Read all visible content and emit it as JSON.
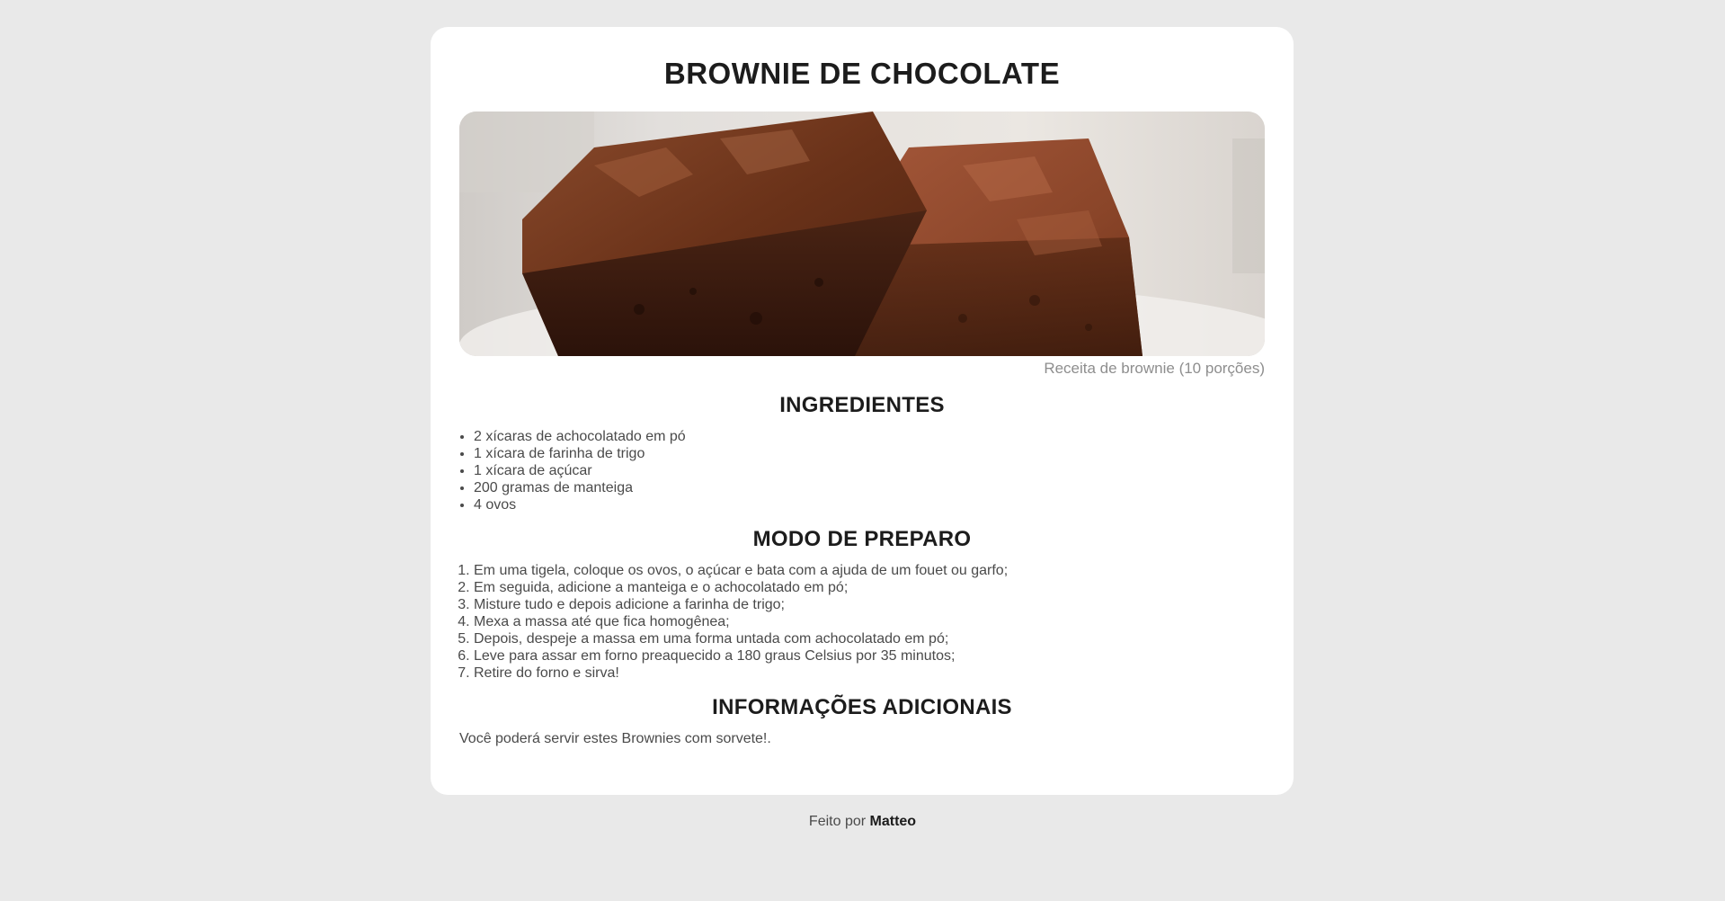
{
  "recipe": {
    "title": "BROWNIE DE CHOCOLATE",
    "image_caption": "Receita de brownie (10 porções)",
    "ingredients_heading": "INGREDIENTES",
    "ingredients": [
      "2 xícaras de achocolatado em pó",
      "1 xícara de farinha de trigo",
      "1 xícara de açúcar",
      "200 gramas de manteiga",
      "4 ovos"
    ],
    "preparation_heading": "MODO DE PREPARO",
    "steps": [
      "Em uma tigela, coloque os ovos, o açúcar e bata com a ajuda de um fouet ou garfo;",
      "Em seguida, adicione a manteiga e o achocolatado em pó;",
      "Misture tudo e depois adicione a farinha de trigo;",
      "Mexa a massa até que fica homogênea;",
      "Depois, despeje a massa em uma forma untada com achocolatado em pó;",
      "Leve para assar em forno preaquecido a 180 graus Celsius por 35 minutos;",
      "Retire do forno e sirva!"
    ],
    "info_heading": "INFORMAÇÕES ADICIONAIS",
    "info_text": "Você poderá servir estes Brownies com sorvete!."
  },
  "footer": {
    "prefix": "Feito por",
    "author": "Matteo"
  },
  "colors": {
    "page_background": "#e9e9e9",
    "card_background": "#ffffff",
    "heading": "#1c1c1c",
    "body_text": "#4a4a4a",
    "caption": "#8e8e8e"
  }
}
